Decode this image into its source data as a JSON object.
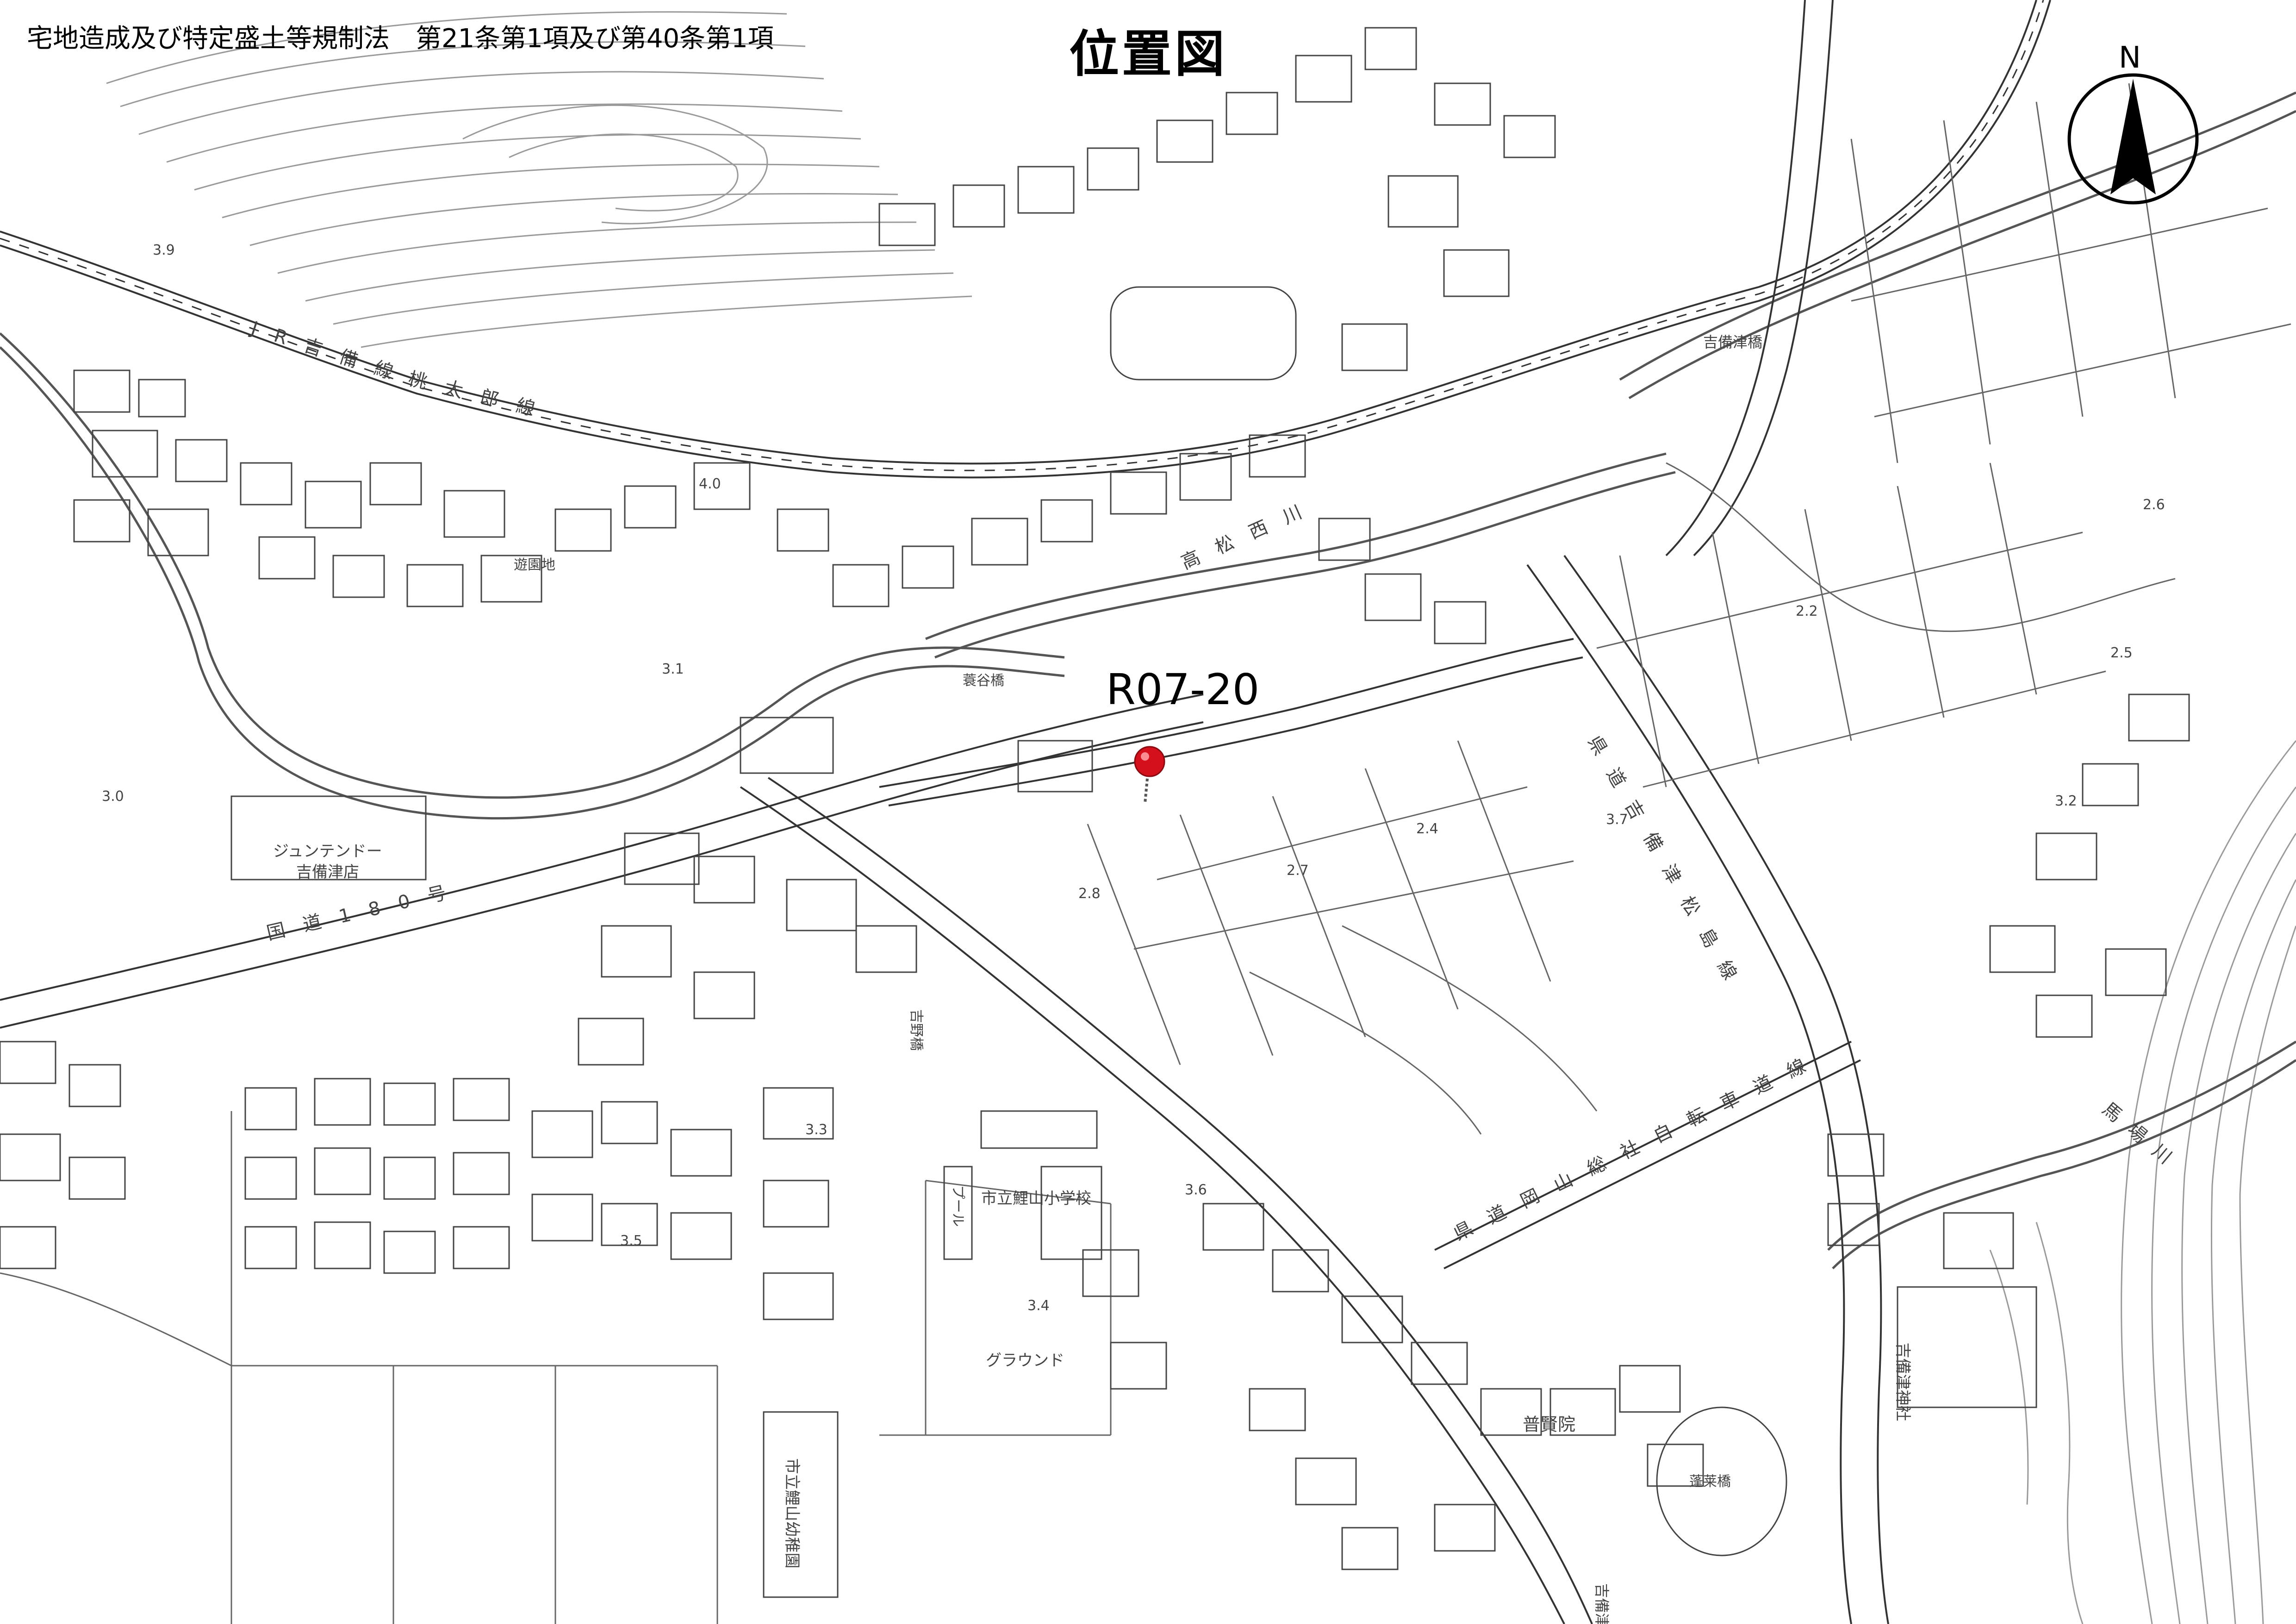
{
  "header": {
    "law_title": "宅地造成及び特定盛土等規制法　第21条第1項及び第40条第1項",
    "map_title": "位置図"
  },
  "site": {
    "code": "R07-20",
    "marker_color": "#d4101c"
  },
  "north_arrow": {
    "label": "N"
  },
  "place_labels": [
    "ジュンテンドー",
    "吉備津店",
    "国道180号",
    "JR吉備線",
    "桃太郎線",
    "高松西川",
    "蓑谷橋",
    "県道吉備津松島線",
    "県道岡山総社自転車道線",
    "吉野橋",
    "市立鯉山小学校",
    "プール",
    "グラウンド",
    "市立鯉山幼稚園",
    "普賢院",
    "吉備津神社",
    "馬場川",
    "吉備津橋",
    "遊園地",
    "蓬莱橋",
    "吉備津"
  ],
  "elevations": [
    "3.9",
    "4.0",
    "3.1",
    "3.0",
    "2.8",
    "2.7",
    "3.3",
    "2.4",
    "2.2",
    "2.5",
    "3.2",
    "3.4",
    "3.6",
    "3.7",
    "2.6",
    "3.5"
  ]
}
